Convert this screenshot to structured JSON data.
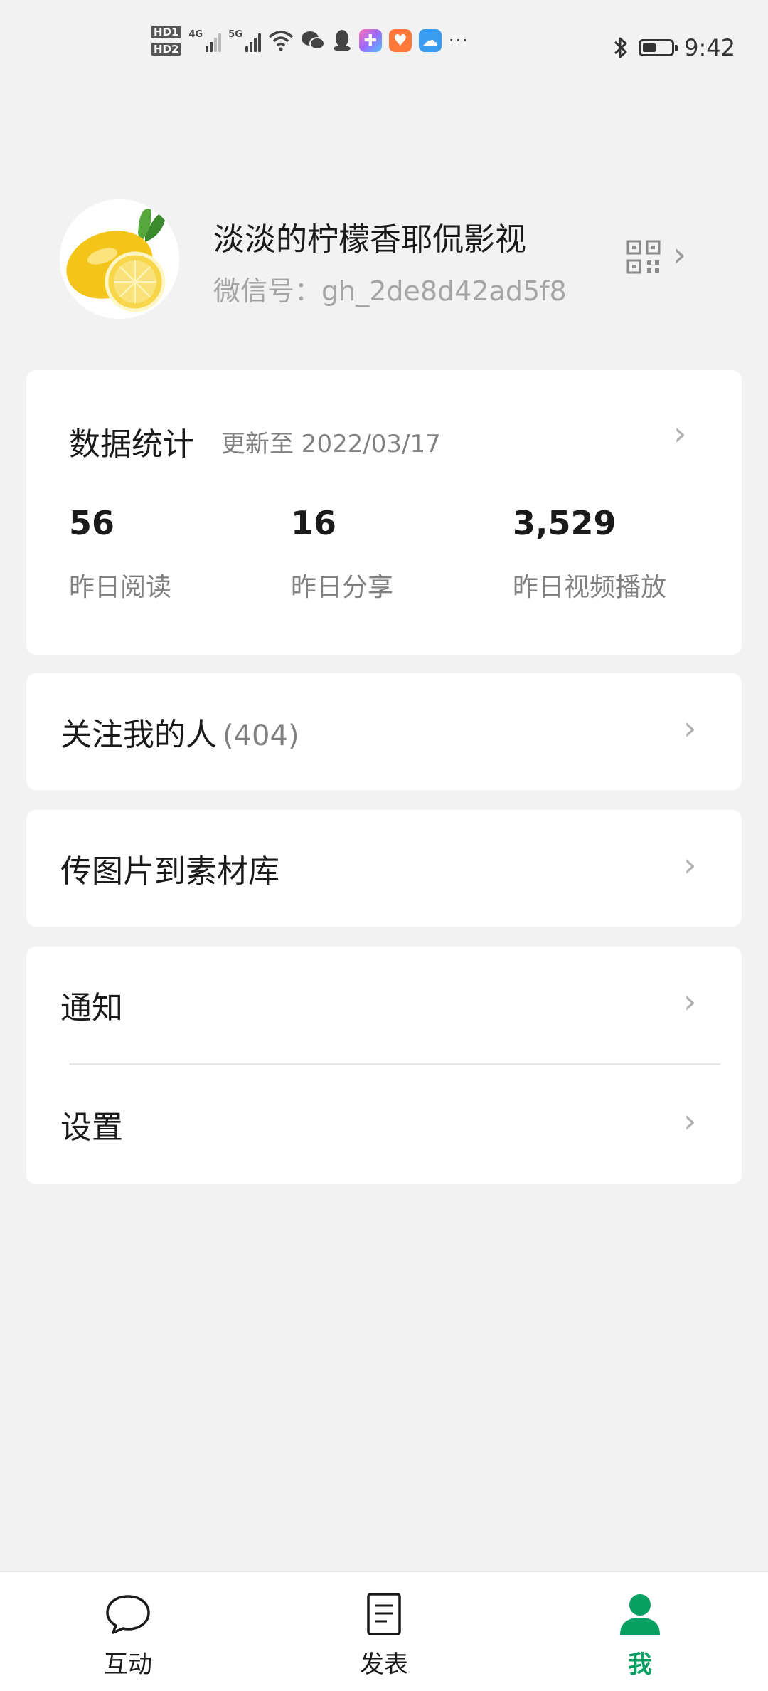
{
  "status_bar": {
    "network_left": "4G",
    "network_right": "5G",
    "more": "···",
    "time": "9:42",
    "battery_level": 0.5
  },
  "profile": {
    "name": "淡淡的柠檬香耶侃影视",
    "wechat_id": "微信号：gh_2de8d42ad5f8"
  },
  "stats": {
    "title": "数据统计",
    "updated": "更新至 2022/03/17",
    "items": [
      {
        "value": "56",
        "label": "昨日阅读"
      },
      {
        "value": "16",
        "label": "昨日分享"
      },
      {
        "value": "3,529",
        "label": "昨日视频播放"
      }
    ]
  },
  "menu": {
    "followers_label": "关注我的人",
    "followers_count": "(404)",
    "upload_label": "传图片到素材库",
    "notify_label": "通知",
    "settings_label": "设置"
  },
  "nav": {
    "tabs": [
      {
        "label": "互动",
        "icon": "chat-bubble-icon"
      },
      {
        "label": "发表",
        "icon": "document-icon"
      },
      {
        "label": "我",
        "icon": "person-icon"
      }
    ],
    "active_color": "#07a062"
  }
}
